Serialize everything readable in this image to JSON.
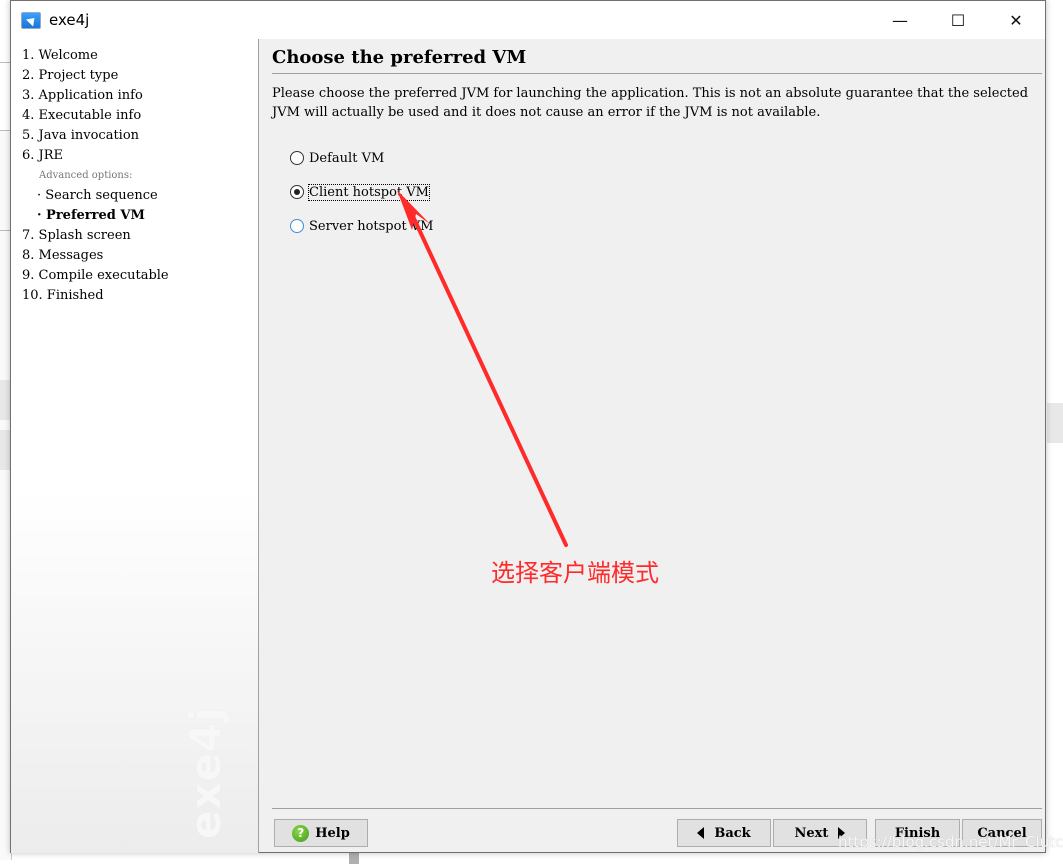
{
  "window": {
    "title": "exe4j",
    "controls": {
      "minimize": "—",
      "maximize": "☐",
      "close": "✕"
    }
  },
  "sidebar": {
    "steps": [
      {
        "label": "1. Welcome"
      },
      {
        "label": "2. Project type"
      },
      {
        "label": "3. Application info"
      },
      {
        "label": "4. Executable info"
      },
      {
        "label": "5. Java invocation"
      },
      {
        "label": "6. JRE"
      }
    ],
    "advanced_label": "Advanced options:",
    "sub_steps": [
      {
        "label": "· Search sequence"
      },
      {
        "label": "· Preferred VM",
        "current": true
      }
    ],
    "steps_after": [
      {
        "label": "7. Splash screen"
      },
      {
        "label": "8. Messages"
      },
      {
        "label": "9. Compile executable"
      },
      {
        "label": "10. Finished"
      }
    ],
    "logo_watermark": "exe4j"
  },
  "main": {
    "title": "Choose the preferred VM",
    "description": "Please choose the preferred JVM for launching the application. This is not an absolute guarantee that the selected JVM will actually be used and it does not cause an error if the JVM is not available.",
    "options": [
      {
        "label": "Default VM",
        "checked": false
      },
      {
        "label": "Client hotspot VM",
        "checked": true
      },
      {
        "label": "Server hotspot VM",
        "checked": false
      }
    ]
  },
  "footer": {
    "help": "Help",
    "back": "Back",
    "next": "Next",
    "finish": "Finish",
    "cancel": "Cancel"
  },
  "annotation": {
    "text": "选择客户端模式",
    "color": "#ff2a2a"
  },
  "watermark_url": "https://blog.csdn.net/Mr_Clutch"
}
